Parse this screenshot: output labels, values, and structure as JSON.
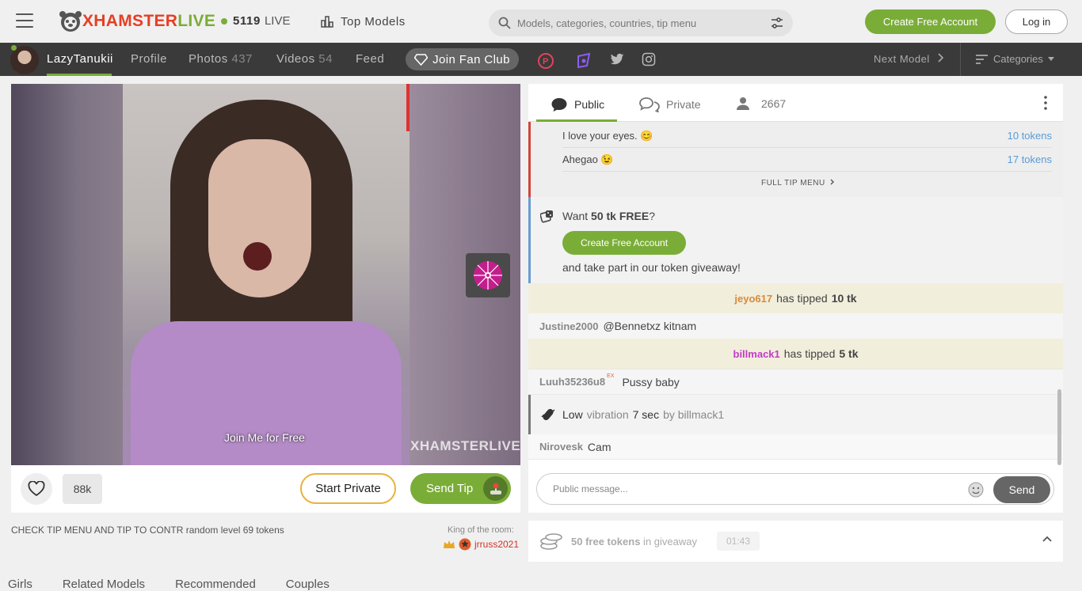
{
  "header": {
    "logo_x": "XHAMSTER",
    "logo_live": "LIVE",
    "live_count": "5119",
    "live_label": "LIVE",
    "top_models": "Top Models",
    "search_placeholder": "Models, categories, countries, tip menu",
    "create_account": "Create Free Account",
    "login": "Log in"
  },
  "model_nav": {
    "name": "LazyTanukii",
    "profile": "Profile",
    "photos_label": "Photos",
    "photos_count": "437",
    "videos_label": "Videos",
    "videos_count": "54",
    "feed": "Feed",
    "fan_club": "Join Fan Club",
    "next_model": "Next Model",
    "categories": "Categories"
  },
  "player": {
    "overlay_text": "Join Me for Free",
    "watermark": "XHAMSTERLIVE",
    "likes": "88k",
    "start_private": "Start Private",
    "send_tip": "Send Tip",
    "topic": "CHECK TIP MENU AND TIP TO CONTR random level 69 tokens",
    "king_label": "King of the room:",
    "king_user": "jrruss2021"
  },
  "bottom_tabs": [
    "Girls",
    "Related Models",
    "Recommended",
    "Couples"
  ],
  "chat": {
    "tabs": {
      "public": "Public",
      "private": "Private",
      "viewers": "2667"
    },
    "tip_menu": [
      {
        "item": "I love your eyes. 😊",
        "price": "10 tokens"
      },
      {
        "item": "Ahegao 😉",
        "price": "17 tokens"
      }
    ],
    "full_tip_menu": "FULL TIP MENU",
    "giveaway_prompt_pre": "Want ",
    "giveaway_prompt_bold": "50 tk FREE",
    "giveaway_prompt_post": "?",
    "giveaway_button": "Create Free Account",
    "giveaway_take": "and take part in our token giveaway!",
    "messages": [
      {
        "type": "tip",
        "user": "jeyo617",
        "text": "has tipped",
        "amount": "10 tk"
      },
      {
        "type": "msg",
        "user": "Justine2000",
        "text": "@Bennetxz kitnam"
      },
      {
        "type": "tip",
        "user": "billmack1",
        "text": "has tipped",
        "amount": "5 tk"
      },
      {
        "type": "msg",
        "user": "Luuh35236u8",
        "badge": "EX",
        "text": "Pussy baby"
      },
      {
        "type": "vibration",
        "level": "Low",
        "label": "vibration",
        "duration": "7 sec",
        "by": "by billmack1"
      },
      {
        "type": "msg",
        "user": "Nirovesk",
        "text": "Cam"
      }
    ],
    "input_placeholder": "Public message...",
    "send": "Send"
  },
  "giveaway_bar": {
    "text_bold": "50 free tokens",
    "text_rest": " in giveaway",
    "timer": "01:43"
  },
  "colors": {
    "accent": "#7aad37",
    "tip_bg": "#f1eedc",
    "nav_bg": "#3a3a3a"
  }
}
